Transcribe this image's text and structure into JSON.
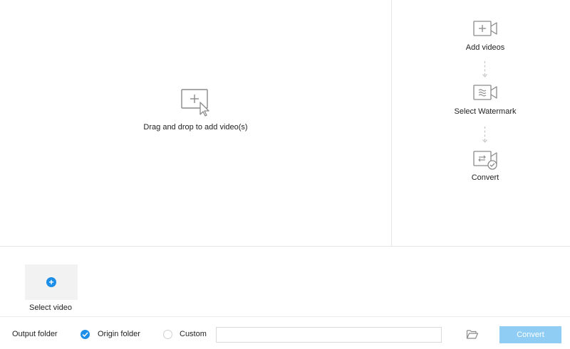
{
  "drop_area": {
    "text": "Drag and drop to add video(s)",
    "icon": "add-video-cursor-icon"
  },
  "steps": [
    {
      "label": "Add videos",
      "icon": "add-video-camera-icon"
    },
    {
      "label": "Select Watermark",
      "icon": "watermark-camera-icon"
    },
    {
      "label": "Convert",
      "icon": "convert-camera-icon"
    }
  ],
  "select_video": {
    "label": "Select video",
    "icon": "plus-circle-icon"
  },
  "output": {
    "label": "Output folder",
    "origin_label": "Origin folder",
    "custom_label": "Custom",
    "selected": "Origin folder",
    "path_value": "",
    "folder_icon": "folder-open-icon"
  },
  "convert_button": {
    "label": "Convert"
  },
  "colors": {
    "accent": "#1e8fe8",
    "convert_disabled": "#8fcdf5",
    "divider": "#e6e6e6",
    "icon_gray": "#8a8a8a"
  }
}
